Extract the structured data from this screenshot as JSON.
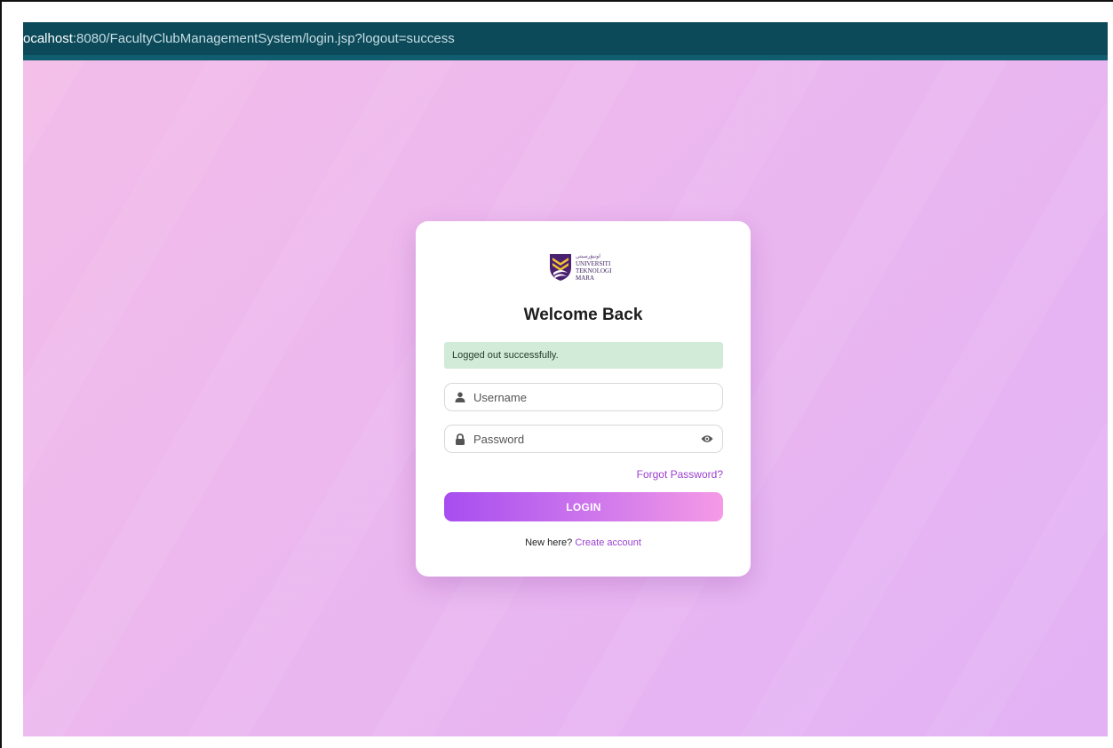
{
  "browser": {
    "url_host": "ocalhost",
    "url_rest": ":8080/FacultyClubManagementSystem/login.jsp?logout=success"
  },
  "login": {
    "logo_line1": "ﺍﻮﻧﻴﯚﺭﺳﻴﺘﻲ",
    "logo_line2": "UNIVERSITI",
    "logo_line3": "TEKNOLOGI",
    "logo_line4": "MARA",
    "title": "Welcome Back",
    "alert": "Logged out successfully.",
    "username_placeholder": "Username",
    "password_placeholder": "Password",
    "forgot_label": "Forgot Password?",
    "login_label": "LOGIN",
    "signup_prompt": "New here?",
    "signup_link": "Create account"
  },
  "colors": {
    "url_bar": "#0c4a5a",
    "background_start": "#f3bde9",
    "background_end": "#e2b2f5",
    "accent": "#9b3fd0",
    "alert_bg": "#d2ead8",
    "button_start": "#a74df0",
    "button_end": "#f59ae6"
  },
  "icons": {
    "username": "user-icon",
    "password": "lock-icon",
    "toggle": "eye-icon"
  }
}
